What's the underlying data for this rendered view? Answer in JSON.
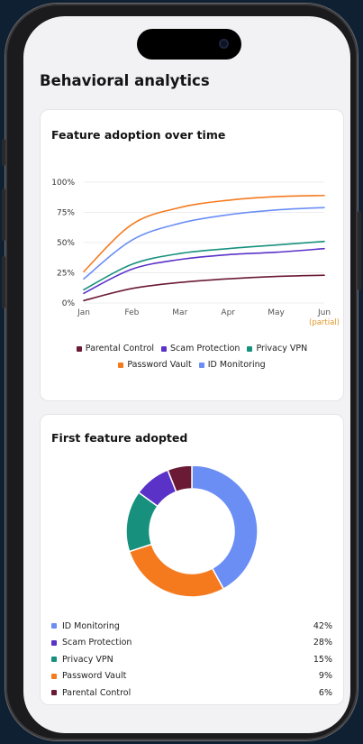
{
  "page": {
    "title": "Behavioral analytics"
  },
  "colors": {
    "parental": "#6b1a35",
    "scam": "#5a32c8",
    "vpn": "#17917e",
    "vault": "#f57a1e",
    "id": "#6b8ef5",
    "partial": "#e0962a"
  },
  "adoption_card": {
    "title": "Feature adoption over time",
    "legend_row1": [
      {
        "label": "Parental Control",
        "color": "#6b1a35"
      },
      {
        "label": "Scam Protection",
        "color": "#5a32c8"
      },
      {
        "label": "Privacy VPN",
        "color": "#17917e"
      }
    ],
    "legend_row2": [
      {
        "label": "Password Vault",
        "color": "#f57a1e"
      },
      {
        "label": "ID Monitoring",
        "color": "#6b8ef5"
      }
    ]
  },
  "donut_card": {
    "title": "First feature adopted",
    "items": [
      {
        "label": "ID Monitoring",
        "value": "42%",
        "color": "#6b8ef5"
      },
      {
        "label": "Scam Protection",
        "value": "28%",
        "color": "#5a32c8"
      },
      {
        "label": "Privacy VPN",
        "value": "15%",
        "color": "#17917e"
      },
      {
        "label": "Password Vault",
        "value": "9%",
        "color": "#f57a1e"
      },
      {
        "label": "Parental Control",
        "value": "6%",
        "color": "#6b1a35"
      }
    ]
  },
  "chart_data": [
    {
      "type": "line",
      "title": "Feature adoption over time",
      "categories": [
        "Jan",
        "Feb",
        "Mar",
        "Apr",
        "May",
        "Jun"
      ],
      "x_annotation": {
        "category": "Jun",
        "text": "(partial)"
      },
      "y_ticks": [
        "0%",
        "25%",
        "50%",
        "75%",
        "100%"
      ],
      "ylim": [
        0,
        100
      ],
      "grid": true,
      "legend_position": "bottom",
      "series": [
        {
          "name": "Parental Control",
          "color": "#6b1a35",
          "values": [
            2,
            12,
            17,
            20,
            22,
            23
          ]
        },
        {
          "name": "Scam Protection",
          "color": "#5a32c8",
          "values": [
            8,
            28,
            36,
            40,
            42,
            45
          ]
        },
        {
          "name": "Privacy VPN",
          "color": "#17917e",
          "values": [
            11,
            32,
            41,
            45,
            48,
            51
          ]
        },
        {
          "name": "Password Vault",
          "color": "#f57a1e",
          "values": [
            26,
            65,
            79,
            85,
            88,
            89
          ]
        },
        {
          "name": "ID Monitoring",
          "color": "#6b8ef5",
          "values": [
            20,
            52,
            66,
            73,
            77,
            79
          ]
        }
      ]
    },
    {
      "type": "pie",
      "title": "First feature adopted",
      "donut": true,
      "categories": [
        "ID Monitoring",
        "Scam Protection",
        "Privacy VPN",
        "Password Vault",
        "Parental Control"
      ],
      "values": [
        42,
        28,
        15,
        9,
        6
      ],
      "colors": [
        "#6b8ef5",
        "#f57a1e",
        "#17917e",
        "#5a32c8",
        "#6b1a35"
      ],
      "legend_position": "bottom"
    }
  ]
}
